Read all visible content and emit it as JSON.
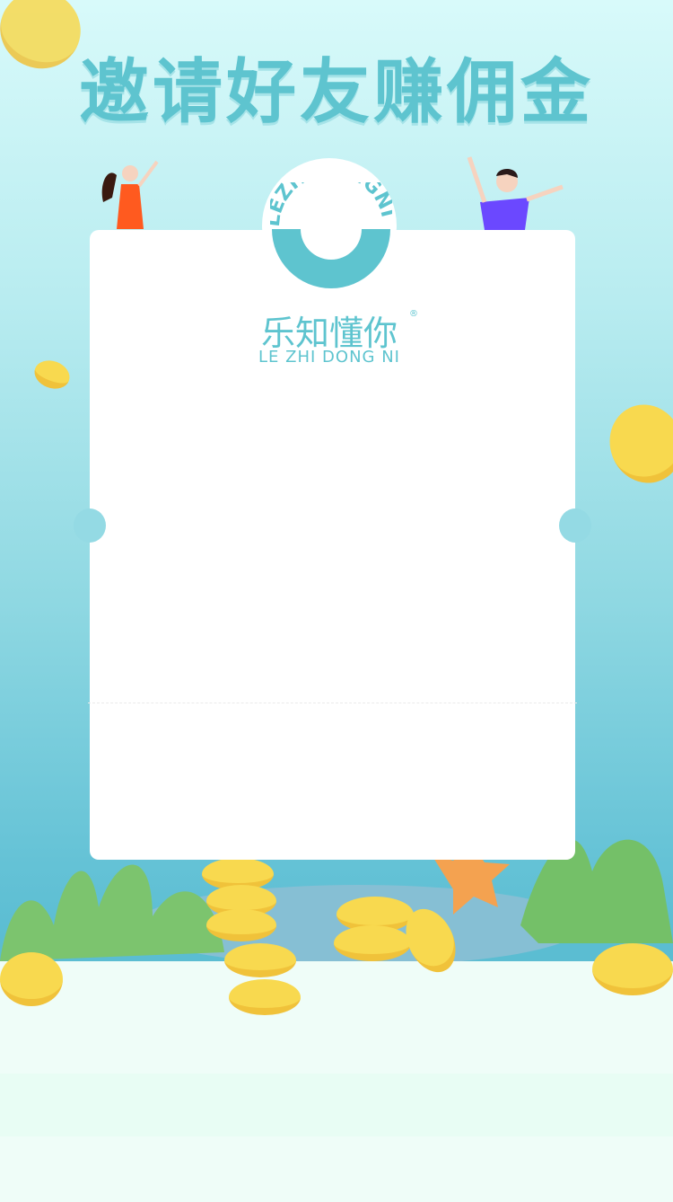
{
  "header": {
    "title": "邀请好友赚佣金"
  },
  "logo": {
    "ring_text": "LEZHIDONGNI",
    "name_cn": "乐知懂你",
    "name_en": "LE ZHI DONG NI",
    "registered": "®"
  },
  "colors": {
    "accent": "#5ec4cf",
    "coin": "#f8d94f",
    "plant": "#7cc46e",
    "card": "#ffffff"
  }
}
